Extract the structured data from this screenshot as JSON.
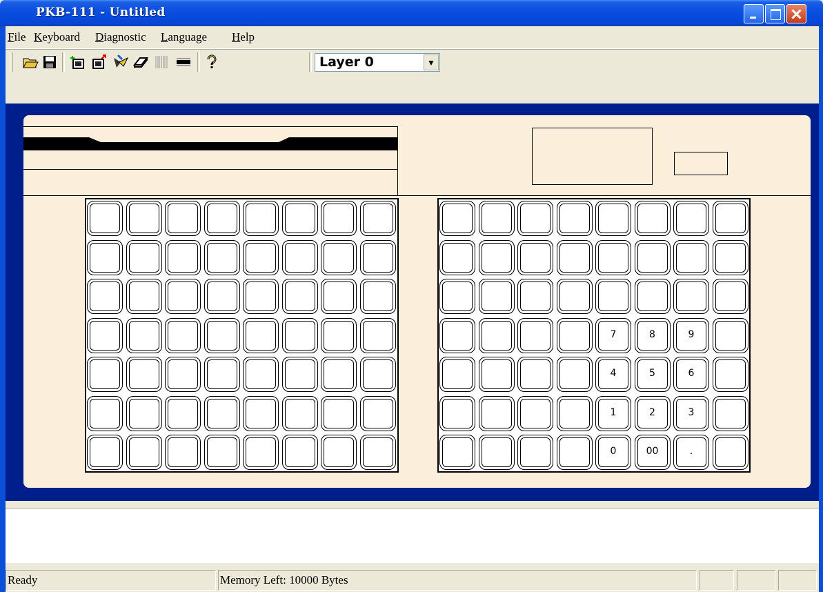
{
  "window": {
    "title": "PKB-111 - Untitled"
  },
  "menu": [
    {
      "label": "File"
    },
    {
      "label": "Keyboard"
    },
    {
      "label": "Diagnostic"
    },
    {
      "label": "Language"
    },
    {
      "label": "Help"
    }
  ],
  "toolbar": {
    "tools": [
      "open-icon",
      "save-icon",
      "insert-key-icon",
      "export-icon",
      "download-icon",
      "eraser-icon",
      "barcode-icon",
      "msr-strip-icon",
      "help-icon"
    ],
    "layer_selected": "Layer 0"
  },
  "keypad_labels": {
    "rows": [
      [
        "",
        "",
        ""
      ],
      [
        "",
        "",
        ""
      ],
      [
        "",
        "",
        ""
      ],
      [
        "7",
        "8",
        "9"
      ],
      [
        "4",
        "5",
        "6"
      ],
      [
        "1",
        "2",
        "3"
      ],
      [
        "0",
        "00",
        "."
      ]
    ]
  },
  "statusbar": {
    "status": "Ready",
    "memory": "Memory Left:  10000 Bytes"
  }
}
